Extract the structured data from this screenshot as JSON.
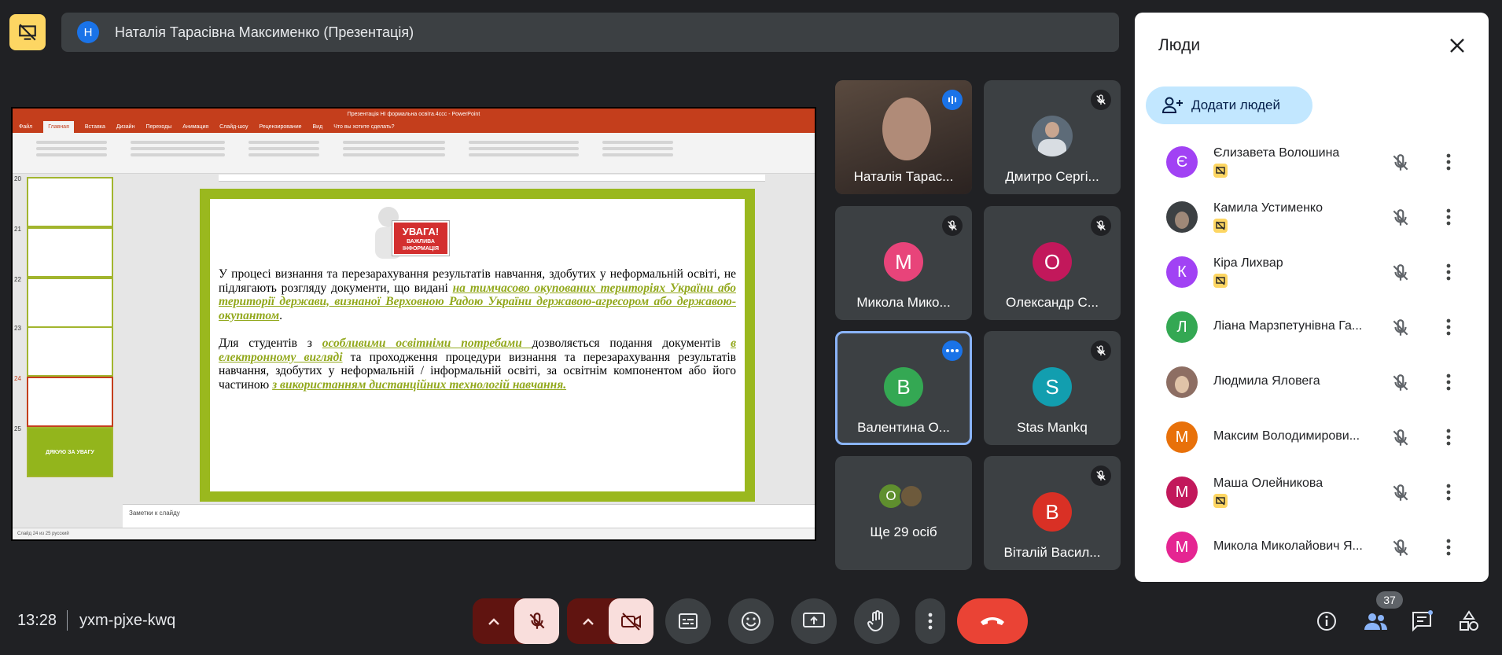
{
  "presentation_bar": {
    "avatar_letter": "Н",
    "title": "Наталія Тарасівна Максименко (Презентація)"
  },
  "shared_screen": {
    "window_title": "Презентація НІ формальна освіта.4ccc - PowerPoint",
    "ribbon_tabs": [
      "Файл",
      "Главная",
      "Вставка",
      "Дизайн",
      "Переходы",
      "Анимация",
      "Слайд-шоу",
      "Рецензирование",
      "Вид",
      "Что вы хотите сделать?"
    ],
    "slide_numbers": [
      "20",
      "21",
      "22",
      "23",
      "24",
      "25"
    ],
    "last_thumb_text": "ДЯКУЮ ЗА УВАГУ",
    "sign_title": "УВАГА!",
    "sign_sub": "ВАЖЛИВА ІНФОРМАЦІЯ",
    "p1_plain": "У процесі визнання та перезарахування результатів навчання, здобутих у неформальній освіті, не підлягають розгляду документи, що видані ",
    "p1_hl": "на тимчасово окупованих територіях України або території держави, визнаної Верховною Радою України державою-агресором або державою-окупантом",
    "p1_end": ".",
    "p2_a": "Для  студентів з ",
    "p2_hl1": "особливими освітніми потребами ",
    "p2_b": "дозволяється подання документів ",
    "p2_hl2": "в електронному вигляді",
    "p2_c": " та проходження процедури визнання та перезарахування результатів навчання, здобутих у неформальній / інформальній освіті, за освітнім компонентом або його частиною ",
    "p2_hl3": "з використанням дистанційних технологій навчання.",
    "notes": "Заметки к слайду",
    "status": "Слайд 24 из 25     русский"
  },
  "tiles": [
    {
      "name": "Наталія Тарас..."
    },
    {
      "name": "Дмитро Сергі..."
    },
    {
      "name": "Микола Мико...",
      "letter": "М"
    },
    {
      "name": "Олександр С...",
      "letter": "О"
    },
    {
      "name": "Валентина О...",
      "letter": "В"
    },
    {
      "name": "Stas Mankq",
      "letter": "S"
    },
    {
      "name": "Ще 29 осіб",
      "letter": "О"
    },
    {
      "name": "Віталій Васил...",
      "letter": "В"
    }
  ],
  "people_panel": {
    "title": "Люди",
    "add_label": "Додати людей",
    "people": [
      {
        "name": "Єлизавета Волошина",
        "letter": "Є",
        "color": "#a142f4"
      },
      {
        "name": "Камила Устименко",
        "letter": "",
        "color": "#3c4043"
      },
      {
        "name": "Кіра Лихвар",
        "letter": "К",
        "color": "#a142f4"
      },
      {
        "name": "Ліана Марзпетунівна Га...",
        "letter": "Л",
        "color": "#34a853"
      },
      {
        "name": "Людмила Яловега",
        "letter": "",
        "color": "#8d6e63"
      },
      {
        "name": "Максим Володимирови...",
        "letter": "М",
        "color": "#e8710a"
      },
      {
        "name": "Маша Олейникова",
        "letter": "М",
        "color": "#c2185b"
      },
      {
        "name": "Микола Миколайович Я...",
        "letter": "М",
        "color": "#e52592"
      }
    ]
  },
  "bottom_bar": {
    "time": "13:28",
    "meeting_code": "yxm-pjxe-kwq",
    "participants_count": "37"
  }
}
